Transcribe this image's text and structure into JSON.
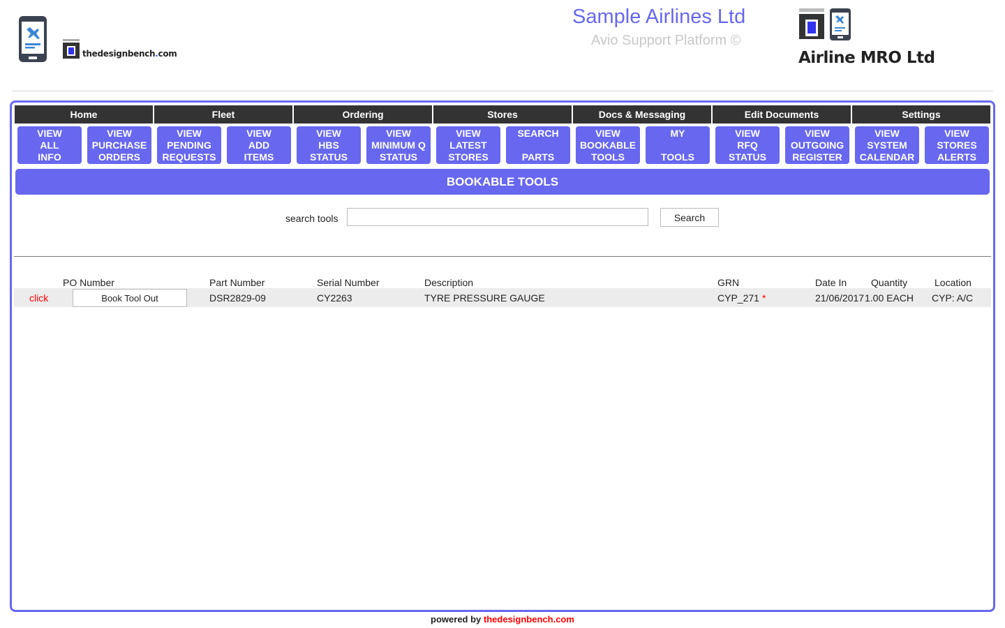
{
  "header": {
    "left_logo_icon": "phone-airplane-icon",
    "bench_logo_icon": "design-bench-box-icon",
    "bench_logo_text": {
      "part1": "thedesign",
      "part2": "bench",
      "part3": ".com"
    },
    "site_title": "Sample Airlines Ltd",
    "site_subtitle": "Avio Support Platform ©",
    "right_logo_icons": [
      "design-bench-box-icon",
      "phone-airplane-icon"
    ],
    "company_name": "Airline MRO Ltd"
  },
  "categories": [
    "Home",
    "Fleet",
    "Ordering",
    "Stores",
    "Docs & Messaging",
    "Edit Documents",
    "Settings"
  ],
  "nav_buttons": [
    {
      "id": "view-all-info",
      "lines": [
        "VIEW",
        "ALL",
        "INFO"
      ]
    },
    {
      "id": "view-purchase-orders",
      "lines": [
        "VIEW",
        "PURCHASE",
        "ORDERS"
      ]
    },
    {
      "id": "view-pending-requests",
      "lines": [
        "VIEW",
        "PENDING",
        "REQUESTS"
      ]
    },
    {
      "id": "view-add-items",
      "lines": [
        "VIEW",
        "ADD",
        "ITEMS"
      ]
    },
    {
      "id": "view-hbs-status",
      "lines": [
        "VIEW",
        "HBS",
        "STATUS"
      ]
    },
    {
      "id": "view-minimum-q-status",
      "lines": [
        "VIEW",
        "MINIMUM Q",
        "STATUS"
      ]
    },
    {
      "id": "view-latest-stores",
      "lines": [
        "VIEW",
        "LATEST",
        "STORES"
      ]
    },
    {
      "id": "search-parts",
      "lines": [
        "SEARCH",
        "",
        "PARTS"
      ]
    },
    {
      "id": "view-bookable-tools",
      "lines": [
        "VIEW",
        "BOOKABLE",
        "TOOLS"
      ]
    },
    {
      "id": "my-tools",
      "lines": [
        "MY",
        "",
        "TOOLS"
      ]
    },
    {
      "id": "view-rfq-status",
      "lines": [
        "VIEW",
        "RFQ",
        "STATUS"
      ]
    },
    {
      "id": "view-outgoing-register",
      "lines": [
        "VIEW",
        "OUTGOING",
        "REGISTER"
      ]
    },
    {
      "id": "view-system-calendar",
      "lines": [
        "VIEW",
        "SYSTEM",
        "CALENDAR"
      ]
    },
    {
      "id": "view-stores-alerts",
      "lines": [
        "VIEW",
        "STORES",
        "ALERTS"
      ]
    }
  ],
  "section_title": "BOOKABLE TOOLS",
  "search": {
    "label": "search tools",
    "value": "",
    "placeholder": "",
    "button_label": "Search"
  },
  "table": {
    "columns": [
      "PO Number",
      "Part Number",
      "Serial Number",
      "Description",
      "GRN",
      "Date In",
      "Quantity",
      "Location"
    ],
    "rows": [
      {
        "action_link": "click",
        "button_label": "Book Tool Out",
        "part_number": "DSR2829-09",
        "serial_number": "CY2263",
        "description": "TYRE PRESSURE GAUGE",
        "grn": "CYP_271",
        "grn_marker": "*",
        "date_in": "21/06/2017",
        "quantity": "1.00 EACH",
        "location": "CYP: A/C"
      }
    ]
  },
  "footer": {
    "prefix": "powered by ",
    "brand": "thedesignbench.com"
  },
  "colors": {
    "accent": "#6767f0",
    "category_bar": "#333333",
    "link_red": "#ff0000",
    "row_bg": "#ececec",
    "subtitle_grey": "#c8c8c8"
  }
}
